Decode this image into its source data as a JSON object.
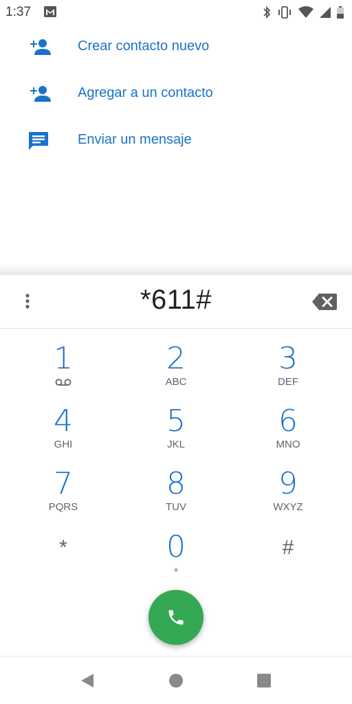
{
  "status_bar": {
    "time": "1:37",
    "icons": [
      "gmail-icon",
      "bluetooth-icon",
      "vibrate-icon",
      "wifi-icon",
      "cell-signal-icon",
      "battery-icon"
    ]
  },
  "actions": [
    {
      "icon": "add-person-icon",
      "label": "Crear contacto nuevo"
    },
    {
      "icon": "add-person-icon",
      "label": "Agregar a un contacto"
    },
    {
      "icon": "message-icon",
      "label": "Enviar un mensaje"
    }
  ],
  "dialpad": {
    "number": "*611#",
    "keys": [
      {
        "digit": "1",
        "letters": ""
      },
      {
        "digit": "2",
        "letters": "ABC"
      },
      {
        "digit": "3",
        "letters": "DEF"
      },
      {
        "digit": "4",
        "letters": "GHI"
      },
      {
        "digit": "5",
        "letters": "JKL"
      },
      {
        "digit": "6",
        "letters": "MNO"
      },
      {
        "digit": "7",
        "letters": "PQRS"
      },
      {
        "digit": "8",
        "letters": "TUV"
      },
      {
        "digit": "9",
        "letters": "WXYZ"
      },
      {
        "digit": "*",
        "letters": ""
      },
      {
        "digit": "0",
        "letters": "+"
      },
      {
        "digit": "#",
        "letters": ""
      }
    ]
  },
  "colors": {
    "accent": "#1a73c8",
    "call": "#34a853",
    "secondary_text": "#5f6368"
  }
}
